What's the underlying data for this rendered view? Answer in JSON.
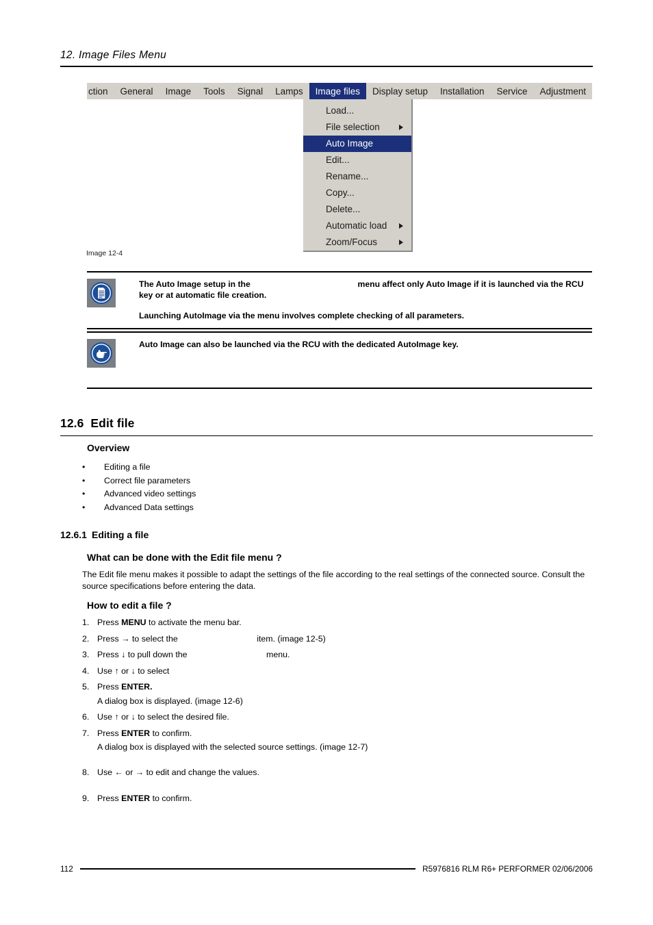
{
  "header": {
    "chapter_title": "12.  Image Files Menu"
  },
  "osd": {
    "menubar": [
      {
        "label": "ction",
        "selected": false,
        "truncated": true
      },
      {
        "label": "General",
        "selected": false
      },
      {
        "label": "Image",
        "selected": false
      },
      {
        "label": "Tools",
        "selected": false
      },
      {
        "label": "Signal",
        "selected": false
      },
      {
        "label": "Lamps",
        "selected": false
      },
      {
        "label": "Image files",
        "selected": true
      },
      {
        "label": "Display setup",
        "selected": false
      },
      {
        "label": "Installation",
        "selected": false
      },
      {
        "label": "Service",
        "selected": false
      },
      {
        "label": "Adjustment",
        "selected": false
      }
    ],
    "dropdown": [
      {
        "label": "Load...",
        "highlighted": false,
        "submenu": false
      },
      {
        "label": "File selection",
        "highlighted": false,
        "submenu": true
      },
      {
        "label": "Auto Image",
        "highlighted": true,
        "submenu": false
      },
      {
        "label": "Edit...",
        "highlighted": false,
        "submenu": false
      },
      {
        "label": "Rename...",
        "highlighted": false,
        "submenu": false
      },
      {
        "label": "Copy...",
        "highlighted": false,
        "submenu": false
      },
      {
        "label": "Delete...",
        "highlighted": false,
        "submenu": false
      },
      {
        "label": "Automatic load",
        "highlighted": false,
        "submenu": true
      },
      {
        "label": "Zoom/Focus",
        "highlighted": false,
        "submenu": true
      }
    ],
    "colors": {
      "menu_background": "#d4d1cb",
      "highlight": "#1b2f7a",
      "highlight_text": "#ffffff"
    },
    "caption": "Image 12-4"
  },
  "notes": [
    {
      "icon": "document-note-icon",
      "lines": [
        {
          "before": "The Auto Image setup in the",
          "gap": true,
          "after": "menu affect only Auto Image if it is launched via the RCU key or at automatic file creation."
        },
        {
          "before": "Launching AutoImage via the menu involves complete checking of all parameters.",
          "gap": false,
          "after": ""
        }
      ]
    },
    {
      "icon": "pointing-hand-tip-icon",
      "lines": [
        {
          "before": "Auto Image can also be launched via the RCU with the dedicated AutoImage key.",
          "gap": false,
          "after": ""
        }
      ]
    }
  ],
  "section": {
    "number": "12.6",
    "title": "Edit file",
    "overview_heading": "Overview",
    "overview_items": [
      "Editing a file",
      "Correct file parameters",
      "Advanced video settings",
      "Advanced Data settings"
    ]
  },
  "subsection": {
    "number": "12.6.1",
    "title": "Editing a file",
    "q1_heading": "What can be done with the Edit file menu ?",
    "q1_paragraph": "The Edit file menu makes it possible to adapt the settings of the file according to the real settings of the connected source. Consult the source specifications before entering the data.",
    "q2_heading": "How to edit a file ?",
    "steps": [
      {
        "num": "1.",
        "pre": "Press ",
        "bold": "MENU",
        "post": " to activate the menu bar.",
        "gap": false,
        "tail": "",
        "sub": ""
      },
      {
        "num": "2.",
        "pre": "Press → to select the ",
        "bold": "",
        "post": "",
        "gap": true,
        "tail": "item.  (image 12-5)",
        "sub": ""
      },
      {
        "num": "3.",
        "pre": "Press ↓ to pull down the ",
        "bold": "",
        "post": "",
        "gap": true,
        "tail": "menu.",
        "sub": ""
      },
      {
        "num": "4.",
        "pre": "Use ↑ or ↓ to select",
        "bold": "",
        "post": "",
        "gap": false,
        "tail": "",
        "sub": ""
      },
      {
        "num": "5.",
        "pre": "Press ",
        "bold": "ENTER.",
        "post": "",
        "gap": false,
        "tail": "",
        "sub": "A dialog box is displayed.  (image 12-6)"
      },
      {
        "num": "6.",
        "pre": "Use ↑ or ↓ to select the desired file.",
        "bold": "",
        "post": "",
        "gap": false,
        "tail": "",
        "sub": ""
      },
      {
        "num": "7.",
        "pre": "Press ",
        "bold": "ENTER",
        "post": " to confirm.",
        "gap": false,
        "tail": "",
        "sub": "A dialog box is displayed with the selected source settings.  (image 12-7)"
      },
      {
        "num": "8.",
        "pre": "Use ← or → to edit and change the values.",
        "bold": "",
        "post": "",
        "gap": false,
        "tail": "",
        "sub": ""
      },
      {
        "num": "9.",
        "pre": "Press ",
        "bold": "ENTER",
        "post": " to confirm.",
        "gap": false,
        "tail": "",
        "sub": ""
      }
    ]
  },
  "footer": {
    "page_number": "112",
    "reference": "R5976816  RLM R6+ PERFORMER  02/06/2006"
  }
}
